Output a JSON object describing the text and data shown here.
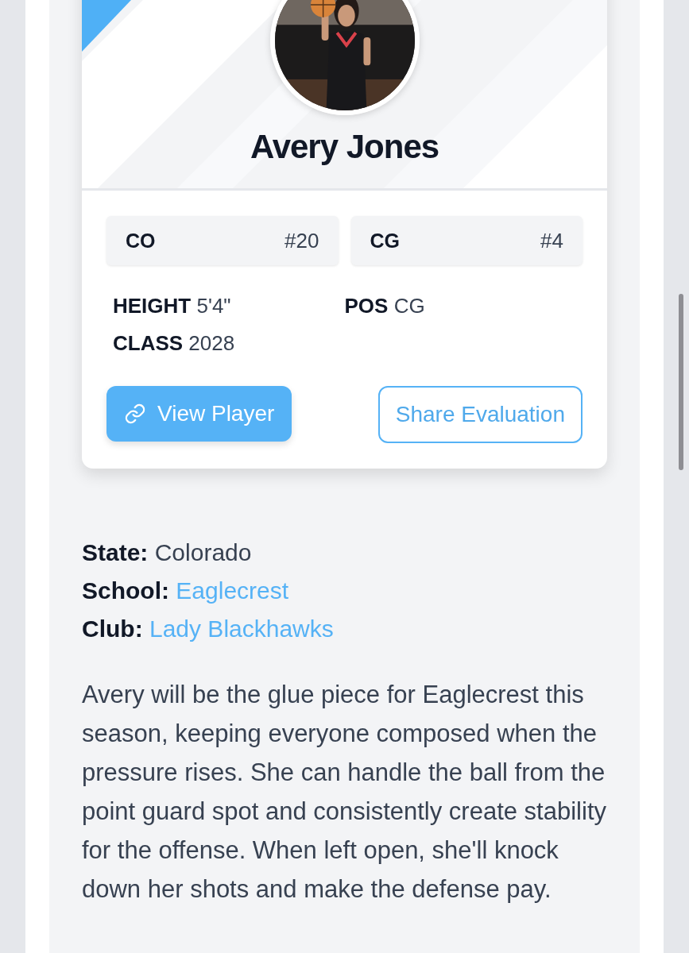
{
  "player": {
    "name": "Avery Jones",
    "badges": [
      {
        "label": "CO",
        "number": "#20"
      },
      {
        "label": "CG",
        "number": "#4"
      }
    ],
    "stats": [
      {
        "label": "HEIGHT",
        "value": "5'4\""
      },
      {
        "label": "POS",
        "value": "CG"
      },
      {
        "label": "CLASS",
        "value": "2028"
      }
    ],
    "buttons": [
      {
        "kind": "primary",
        "label": "View Player"
      },
      {
        "kind": "outline",
        "label": "Share Evaluation"
      }
    ]
  },
  "details": [
    {
      "label": "State:",
      "value": "Colorado",
      "kind": "text"
    },
    {
      "label": "School:",
      "value": "Eaglecrest",
      "kind": "link"
    },
    {
      "label": "Club:",
      "value": "Lady Blackhawks",
      "kind": "link"
    }
  ],
  "description": "Avery will be the glue piece for Eaglecrest this season, keeping everyone composed when the pressure rises. She can handle the ball from the point guard spot and consistently create stability for the offense. When left open, she'll knock down her shots and make the defense pay."
}
